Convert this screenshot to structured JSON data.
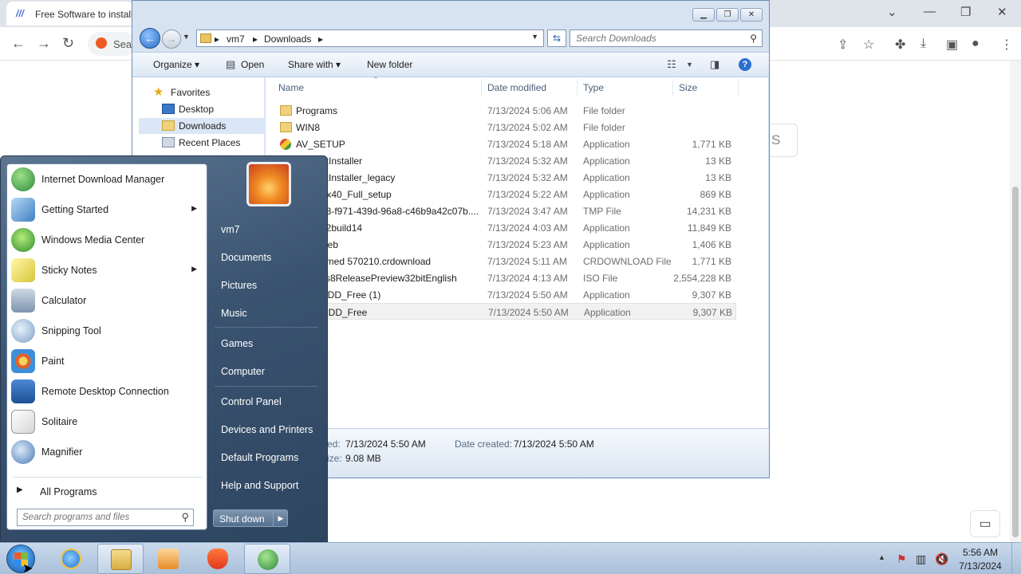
{
  "browser": {
    "tab_title": "Free Software to install",
    "tab_icon": "///",
    "omnibox_text": "Sea",
    "page_button_text": "S",
    "controls": {
      "minimize": "—",
      "maximize": "❐",
      "close": "✕",
      "tab_dropdown": "⌄"
    }
  },
  "explorer": {
    "breadcrumb": [
      "vm7",
      "Downloads"
    ],
    "search_placeholder": "Search Downloads",
    "commands": {
      "organize": "Organize",
      "open": "Open",
      "share_with": "Share with",
      "new_folder": "New folder"
    },
    "nav": {
      "favorites": "Favorites",
      "desktop": "Desktop",
      "downloads": "Downloads",
      "recent_places": "Recent Places"
    },
    "columns": {
      "name": "Name",
      "date_modified": "Date modified",
      "type": "Type",
      "size": "Size"
    },
    "files": [
      {
        "name": "Programs",
        "date": "7/13/2024 5:06 AM",
        "type": "File folder",
        "size": ""
      },
      {
        "name": "WIN8",
        "date": "7/13/2024 5:02 AM",
        "type": "File folder",
        "size": ""
      },
      {
        "name": "AV_SETUP",
        "date": "7/13/2024 5:18 AM",
        "type": "Application",
        "size": "1,771 KB"
      },
      {
        "name": "etInstaller",
        "date": "7/13/2024 5:32 AM",
        "type": "Application",
        "size": "13 KB"
      },
      {
        "name": "etInstaller_legacy",
        "date": "7/13/2024 5:32 AM",
        "type": "Application",
        "size": "13 KB"
      },
      {
        "name": "Fx40_Full_setup",
        "date": "7/13/2024 5:22 AM",
        "type": "Application",
        "size": "869 KB"
      },
      {
        "name": "53-f971-439d-96a8-c46b9a42c07b....",
        "date": "7/13/2024 3:47 AM",
        "type": "TMP File",
        "size": "14,231 KB"
      },
      {
        "name": "42build14",
        "date": "7/13/2024 4:03 AM",
        "type": "Application",
        "size": "11,849 KB"
      },
      {
        "name": "web",
        "date": "7/13/2024 5:23 AM",
        "type": "Application",
        "size": "1,406 KB"
      },
      {
        "name": "irmed 570210.crdownload",
        "date": "7/13/2024 5:11 AM",
        "type": "CRDOWNLOAD File",
        "size": "1,771 KB"
      },
      {
        "name": "vs8ReleasePreview32bitEnglish",
        "date": "7/13/2024 4:13 AM",
        "type": "ISO File",
        "size": "2,554,228 KB"
      },
      {
        "name": "HDD_Free (1)",
        "date": "7/13/2024 5:50 AM",
        "type": "Application",
        "size": "9,307 KB"
      },
      {
        "name": "HDD_Free",
        "date": "7/13/2024 5:50 AM",
        "type": "Application",
        "size": "9,307 KB"
      }
    ],
    "details": {
      "modified_label": "ed:",
      "modified_value": "7/13/2024 5:50 AM",
      "created_label": "Date created:",
      "created_value": "7/13/2024 5:50 AM",
      "size_label": "ize:",
      "size_value": "9.08 MB"
    }
  },
  "start_menu": {
    "programs": [
      {
        "label": "Internet Download Manager",
        "icon": "idm-icon",
        "submenu": false
      },
      {
        "label": "Getting Started",
        "icon": "getting-started-icon",
        "submenu": true
      },
      {
        "label": "Windows Media Center",
        "icon": "media-center-icon",
        "submenu": false
      },
      {
        "label": "Sticky Notes",
        "icon": "sticky-notes-icon",
        "submenu": true
      },
      {
        "label": "Calculator",
        "icon": "calculator-icon",
        "submenu": false
      },
      {
        "label": "Snipping Tool",
        "icon": "snipping-tool-icon",
        "submenu": false
      },
      {
        "label": "Paint",
        "icon": "paint-icon",
        "submenu": false
      },
      {
        "label": "Remote Desktop Connection",
        "icon": "remote-desktop-icon",
        "submenu": false
      },
      {
        "label": "Solitaire",
        "icon": "solitaire-icon",
        "submenu": false
      },
      {
        "label": "Magnifier",
        "icon": "magnifier-icon",
        "submenu": false
      }
    ],
    "all_programs": "All Programs",
    "search_placeholder": "Search programs and files",
    "right": {
      "user": "vm7",
      "documents": "Documents",
      "pictures": "Pictures",
      "music": "Music",
      "games": "Games",
      "computer": "Computer",
      "control_panel": "Control Panel",
      "devices_printers": "Devices and Printers",
      "default_programs": "Default Programs",
      "help_support": "Help and Support"
    },
    "shutdown": "Shut down"
  },
  "taskbar": {
    "time": "5:56 AM",
    "date": "7/13/2024"
  }
}
